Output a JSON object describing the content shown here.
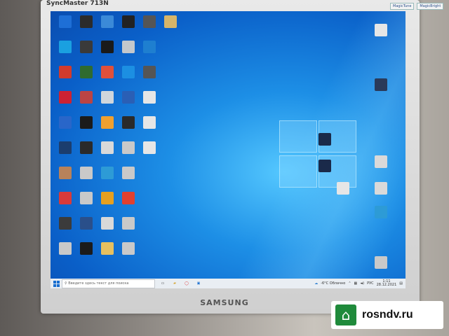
{
  "monitor": {
    "model": "SyncMaster 713N",
    "brand": "SAMSUNG",
    "badges": [
      "MagicTune",
      "MagicBright"
    ]
  },
  "desktop": {
    "icons": [
      {
        "label": "",
        "color": "#1e6fd6",
        "col": 0,
        "row": 0
      },
      {
        "label": "",
        "color": "#2b2b2b",
        "col": 1,
        "row": 0
      },
      {
        "label": "",
        "color": "#3b8ad8",
        "col": 2,
        "row": 0
      },
      {
        "label": "",
        "color": "#222",
        "col": 3,
        "row": 0
      },
      {
        "label": "",
        "color": "#555",
        "col": 4,
        "row": 0
      },
      {
        "label": "",
        "color": "#d6b56a",
        "col": 5,
        "row": 0
      },
      {
        "label": "",
        "color": "#1aa0e0",
        "col": 0,
        "row": 1
      },
      {
        "label": "",
        "color": "#3a3a3a",
        "col": 1,
        "row": 1
      },
      {
        "label": "",
        "color": "#1a1a1a",
        "col": 2,
        "row": 1
      },
      {
        "label": "",
        "color": "#c4c8cc",
        "col": 3,
        "row": 1
      },
      {
        "label": "",
        "color": "#1e7fd0",
        "col": 4,
        "row": 1
      },
      {
        "label": "",
        "color": "#d23b2c",
        "col": 0,
        "row": 2
      },
      {
        "label": "",
        "color": "#2f6b2f",
        "col": 1,
        "row": 2
      },
      {
        "label": "",
        "color": "#e0503a",
        "col": 2,
        "row": 2
      },
      {
        "label": "",
        "color": "#1c8fe2",
        "col": 3,
        "row": 2
      },
      {
        "label": "",
        "color": "#555",
        "col": 4,
        "row": 2
      },
      {
        "label": "",
        "color": "#c23",
        "col": 0,
        "row": 3
      },
      {
        "label": "",
        "color": "#b44",
        "col": 1,
        "row": 3
      },
      {
        "label": "",
        "color": "#cfd6dc",
        "col": 2,
        "row": 3
      },
      {
        "label": "",
        "color": "#2a5fb5",
        "col": 3,
        "row": 3
      },
      {
        "label": "",
        "color": "#e6e6e6",
        "col": 4,
        "row": 3
      },
      {
        "label": "",
        "color": "#2966c9",
        "col": 0,
        "row": 4
      },
      {
        "label": "",
        "color": "#1b1b1b",
        "col": 1,
        "row": 4
      },
      {
        "label": "",
        "color": "#f0a030",
        "col": 2,
        "row": 4
      },
      {
        "label": "",
        "color": "#2a2a2a",
        "col": 3,
        "row": 4
      },
      {
        "label": "",
        "color": "#e6e6e6",
        "col": 4,
        "row": 4
      },
      {
        "label": "",
        "color": "#1b3d6e",
        "col": 0,
        "row": 5
      },
      {
        "label": "",
        "color": "#2a2a2a",
        "col": 1,
        "row": 5
      },
      {
        "label": "",
        "color": "#d9d9d9",
        "col": 2,
        "row": 5
      },
      {
        "label": "",
        "color": "#c9c9c9",
        "col": 3,
        "row": 5
      },
      {
        "label": "",
        "color": "#e6e6e6",
        "col": 4,
        "row": 5
      },
      {
        "label": "",
        "color": "#b8825a",
        "col": 0,
        "row": 6
      },
      {
        "label": "",
        "color": "#c9c9c9",
        "col": 1,
        "row": 6
      },
      {
        "label": "",
        "color": "#2d9bd6",
        "col": 2,
        "row": 6
      },
      {
        "label": "",
        "color": "#c9c9c9",
        "col": 3,
        "row": 6
      },
      {
        "label": "",
        "color": "#d83a3a",
        "col": 0,
        "row": 7
      },
      {
        "label": "",
        "color": "#c9c9c9",
        "col": 1,
        "row": 7
      },
      {
        "label": "",
        "color": "#e6a020",
        "col": 2,
        "row": 7
      },
      {
        "label": "",
        "color": "#e04030",
        "col": 3,
        "row": 7
      },
      {
        "label": "",
        "color": "#3b3b3b",
        "col": 0,
        "row": 8
      },
      {
        "label": "",
        "color": "#2a4f8a",
        "col": 1,
        "row": 8
      },
      {
        "label": "",
        "color": "#d9d9d9",
        "col": 2,
        "row": 8
      },
      {
        "label": "",
        "color": "#c9c9c9",
        "col": 3,
        "row": 8
      },
      {
        "label": "",
        "color": "#c9c9c9",
        "col": 0,
        "row": 9
      },
      {
        "label": "",
        "color": "#1b1b1b",
        "col": 1,
        "row": 9
      },
      {
        "label": "",
        "color": "#e6c060",
        "col": 2,
        "row": 9
      },
      {
        "label": "",
        "color": "#c9c9c9",
        "col": 3,
        "row": 9
      }
    ],
    "right_icons": [
      {
        "label": "",
        "color": "#e6e6e6"
      },
      {
        "label": "",
        "color": "#2a3a5a"
      },
      {
        "label": "",
        "color": "#d9d9d9"
      },
      {
        "label": "",
        "color": "#d9d9d9"
      },
      {
        "label": "",
        "color": "#2d9bd6"
      },
      {
        "label": "",
        "color": "#c9c9c9"
      }
    ],
    "center_icons": [
      {
        "label": "",
        "color": "#1a2a4a"
      },
      {
        "label": "",
        "color": "#1a2a4a"
      },
      {
        "label": "",
        "color": "#e6e6e6"
      }
    ]
  },
  "taskbar": {
    "search_placeholder": "Введите здесь текст для поиска",
    "weather": "-6°C Облачно",
    "time": "1:11",
    "date": "28.12.2021",
    "start_icon": "windows-icon",
    "accent": "#1a6fd0"
  },
  "watermark": {
    "site": "rosndv.ru"
  }
}
